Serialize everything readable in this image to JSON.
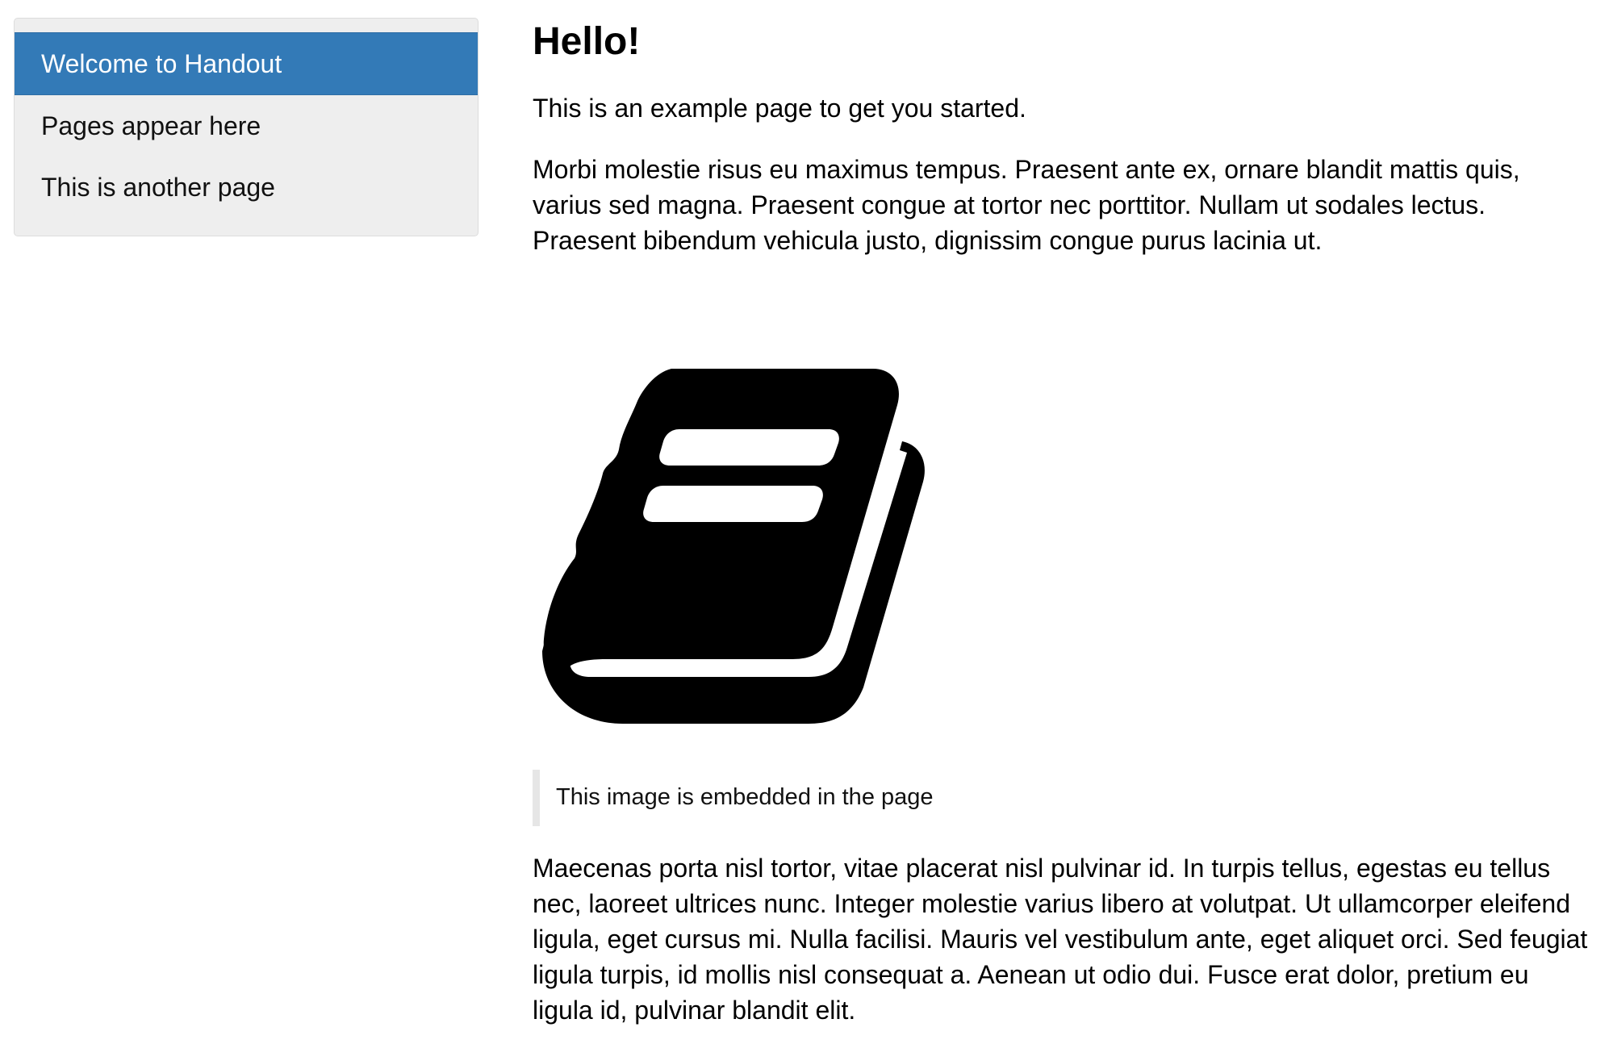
{
  "sidebar": {
    "items": [
      {
        "label": "Welcome to Handout",
        "active": true
      },
      {
        "label": "Pages appear here",
        "active": false
      },
      {
        "label": "This is another page",
        "active": false
      }
    ],
    "active_color": "#337ab7"
  },
  "main": {
    "title": "Hello!",
    "intro": "This is an example page to get you started.",
    "paragraph1": "Morbi molestie risus eu maximus tempus. Praesent ante ex, ornare blandit mattis quis, varius sed magna. Praesent congue at tortor nec porttitor. Nullam ut sodales lectus. Praesent bibendum vehicula justo, dignissim congue purus lacinia ut.",
    "image": {
      "icon": "book-icon"
    },
    "caption": "This image is embedded in the page",
    "paragraph2": "Maecenas porta nisl tortor, vitae placerat nisl pulvinar id. In turpis tellus, egestas eu tellus nec, laoreet ultrices nunc. Integer molestie varius libero at volutpat. Ut ullamcorper eleifend ligula, eget cursus mi. Nulla facilisi. Mauris vel vestibulum ante, eget aliquet orci. Sed feugiat ligula turpis, id mollis nisl consequat a. Aenean ut odio dui. Fusce erat dolor, pretium eu ligula id, pulvinar blandit elit."
  }
}
